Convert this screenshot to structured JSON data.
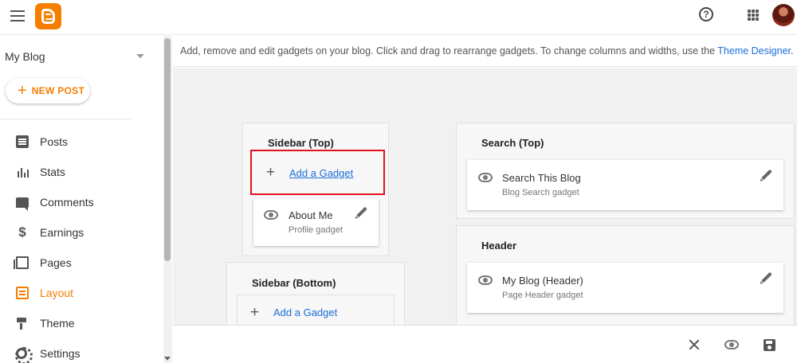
{
  "header": {
    "menu_icon": "menu-icon",
    "logo": "blogger-logo",
    "help_icon": "help-icon",
    "help_glyph": "?",
    "apps_icon": "apps-grid-icon",
    "avatar": "account-avatar"
  },
  "sidebar": {
    "blog_name": "My Blog",
    "new_post_label": "NEW POST",
    "new_post_plus": "+",
    "items": [
      {
        "label": "Posts",
        "icon": "posts-icon"
      },
      {
        "label": "Stats",
        "icon": "stats-icon"
      },
      {
        "label": "Comments",
        "icon": "comments-icon"
      },
      {
        "label": "Earnings",
        "icon": "dollar-icon",
        "glyph": "$"
      },
      {
        "label": "Pages",
        "icon": "pages-icon"
      },
      {
        "label": "Layout",
        "icon": "layout-icon",
        "active": true
      },
      {
        "label": "Theme",
        "icon": "theme-icon"
      },
      {
        "label": "Settings",
        "icon": "gear-icon"
      }
    ]
  },
  "main": {
    "info_text": "Add, remove and edit gadgets on your blog. Click and drag to rearrange gadgets. To change columns and widths, use the ",
    "info_link": "Theme Designer",
    "info_end": ".",
    "sections": {
      "sidebar_top": {
        "title": "Sidebar (Top)",
        "add_plus": "+",
        "add_label": "Add a Gadget",
        "gadget": {
          "title": "About Me",
          "subtitle": "Profile gadget"
        }
      },
      "sidebar_bottom": {
        "title": "Sidebar (Bottom)",
        "add_plus": "+",
        "add_label": "Add a Gadget"
      },
      "search_top": {
        "title": "Search (Top)",
        "gadget": {
          "title": "Search This Blog",
          "subtitle": "Blog Search gadget"
        }
      },
      "header": {
        "title": "Header",
        "gadget": {
          "title": "My Blog (Header)",
          "subtitle": "Page Header gadget"
        }
      }
    }
  },
  "actions": {
    "close_icon": "close-icon",
    "preview_icon": "preview-eye-icon",
    "save_icon": "save-icon"
  },
  "colors": {
    "accent": "#f57d00",
    "link": "#1a6ed8",
    "highlight": "#e3121b"
  }
}
